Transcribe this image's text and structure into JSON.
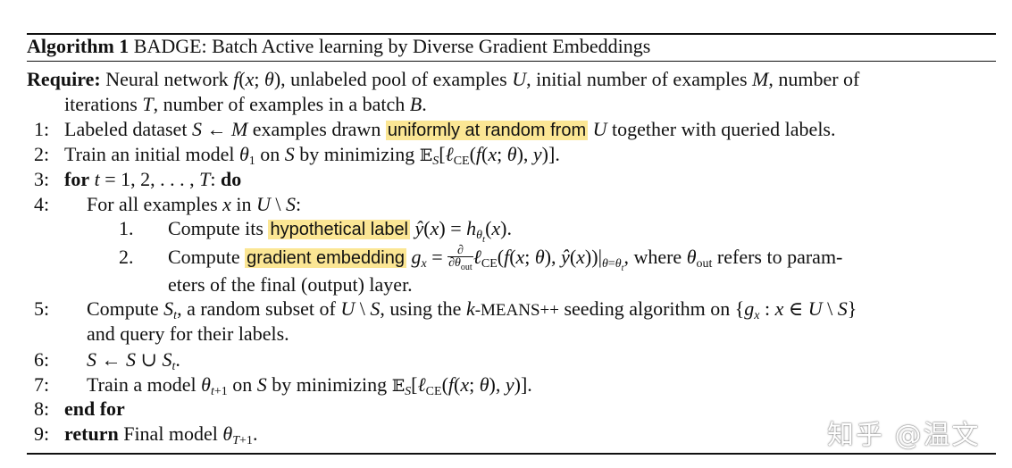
{
  "caption": {
    "label": "Algorithm 1",
    "title": "BADGE: Batch Active learning by Diverse Gradient Embeddings"
  },
  "require": {
    "label": "Require:",
    "text_1a": "Neural network",
    "text_1b": ", unlabeled pool of examples",
    "text_1c": ", initial number of examples",
    "text_1d": ", number of",
    "text_2a": "iterations",
    "text_2b": ", number of examples in a batch",
    "text_2c": "."
  },
  "steps": {
    "s1": {
      "num": "1:",
      "a": "Labeled dataset",
      "b": "examples drawn",
      "hl": "uniformly at random from",
      "c": "together with queried labels."
    },
    "s2": {
      "num": "2:",
      "a": "Train an initial model",
      "b": "on",
      "c": "by minimizing"
    },
    "s3": {
      "num": "3:",
      "kw_for": "for",
      "kw_do": "do"
    },
    "s4": {
      "num": "4:",
      "a": "For all examples",
      "b": "in"
    },
    "s4_1": {
      "num": "1.",
      "a": "Compute its",
      "hl": "hypothetical label"
    },
    "s4_2": {
      "num": "2.",
      "a": "Compute",
      "hl": "gradient embedding",
      "b": ", where",
      "c": "refers to param-",
      "d": "eters of the final (output) layer."
    },
    "s5": {
      "num": "5:",
      "a": "Compute",
      "b": ", a random subset of",
      "c": ", using the",
      "sc": "-MEANS++",
      "d": "seeding algorithm on",
      "e": "and query for their labels."
    },
    "s6": {
      "num": "6:"
    },
    "s7": {
      "num": "7:",
      "a": "Train a model",
      "b": "on",
      "c": "by minimizing"
    },
    "s8": {
      "num": "8:",
      "kw": "end for"
    },
    "s9": {
      "num": "9:",
      "kw": "return",
      "a": "Final model"
    }
  },
  "watermark": "知乎 @温文"
}
